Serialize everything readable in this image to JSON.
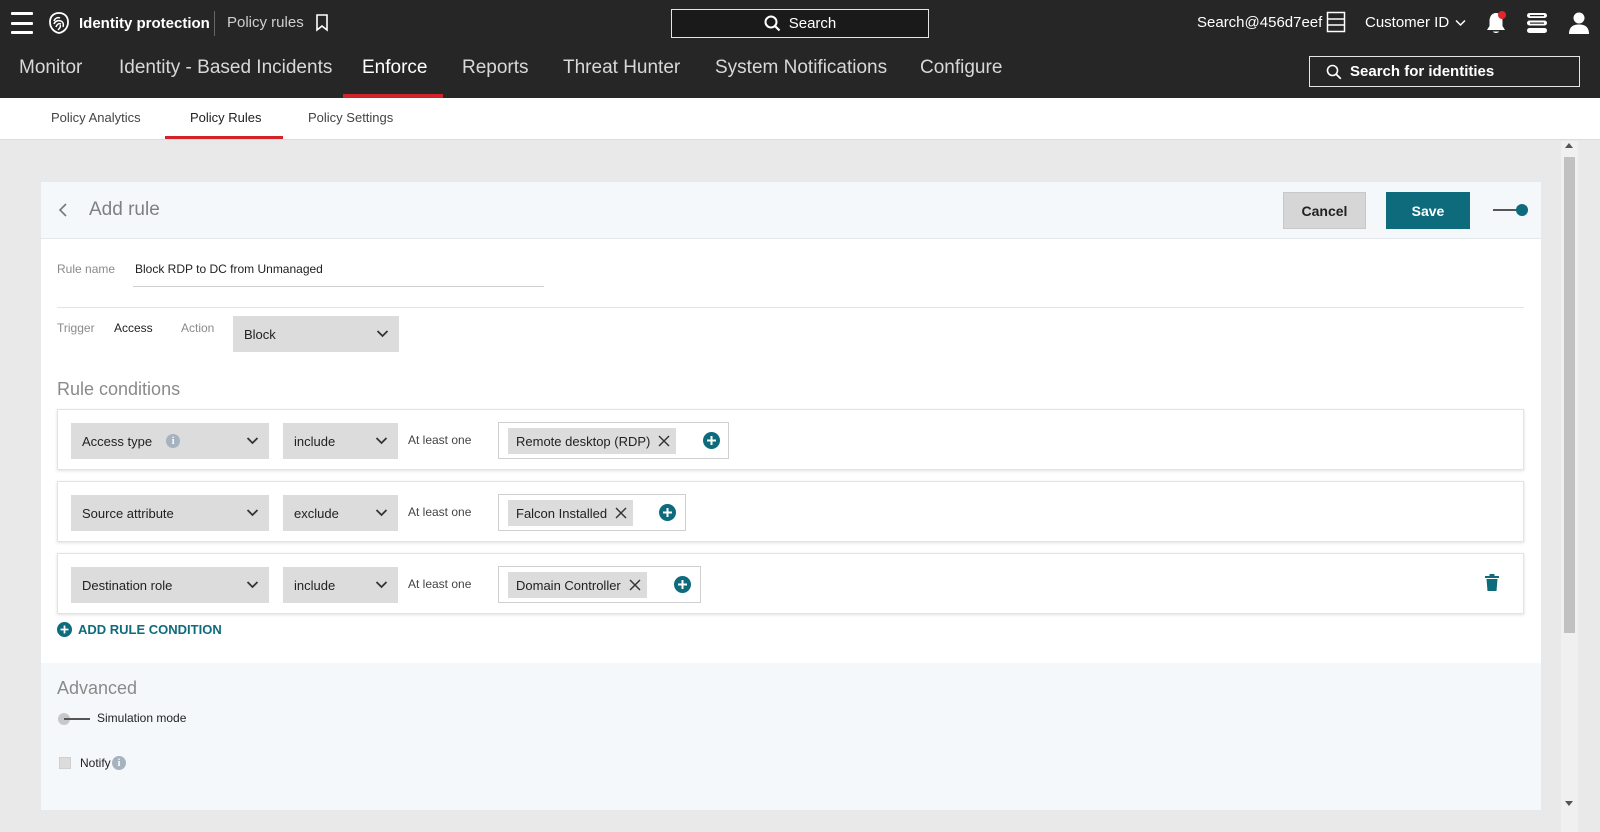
{
  "topbar": {
    "app_name": "Identity protection",
    "breadcrumb": "Policy rules",
    "search_label": "Search",
    "user": "Search@456d7eef",
    "customer_label": "Customer ID",
    "icons": [
      "menu-icon",
      "logo-icon",
      "bookmark-icon",
      "search-icon",
      "server-icon",
      "chevron-down-icon",
      "bell-icon",
      "chat-icon",
      "user-icon"
    ]
  },
  "main_nav": {
    "items": [
      "Monitor",
      "Identity - Based Incidents",
      "Enforce",
      "Reports",
      "Threat Hunter",
      "System Notifications",
      "Configure"
    ],
    "active": "Enforce",
    "identity_search_label": "Search for identities"
  },
  "sub_nav": {
    "items": [
      "Policy Analytics",
      "Policy Rules",
      "Policy Settings"
    ],
    "active": "Policy Rules"
  },
  "rule": {
    "title": "Add rule",
    "cancel_label": "Cancel",
    "save_label": "Save",
    "enabled": true,
    "rule_name_label": "Rule name",
    "rule_name_value": "Block RDP to DC from Unmanaged",
    "trigger_label": "Trigger",
    "trigger_value": "Access",
    "action_label": "Action",
    "action_value": "Block"
  },
  "conditions": {
    "title": "Rule conditions",
    "rows": [
      {
        "attribute": "Access type",
        "operator": "include",
        "match": "At least one",
        "values": [
          "Remote desktop (RDP)"
        ]
      },
      {
        "attribute": "Source attribute",
        "operator": "exclude",
        "match": "At least one",
        "values": [
          "Falcon Installed"
        ]
      },
      {
        "attribute": "Destination role",
        "operator": "include",
        "match": "At least one",
        "values": [
          "Domain Controller"
        ]
      }
    ],
    "add_label": "ADD RULE CONDITION"
  },
  "advanced": {
    "title": "Advanced",
    "simulation_label": "Simulation mode",
    "simulation_on": false,
    "notify_label": "Notify",
    "notify_checked": false
  },
  "colors": {
    "accent": "#0d6b7c",
    "active_tab": "#d3222a",
    "topbar": "#262626"
  }
}
